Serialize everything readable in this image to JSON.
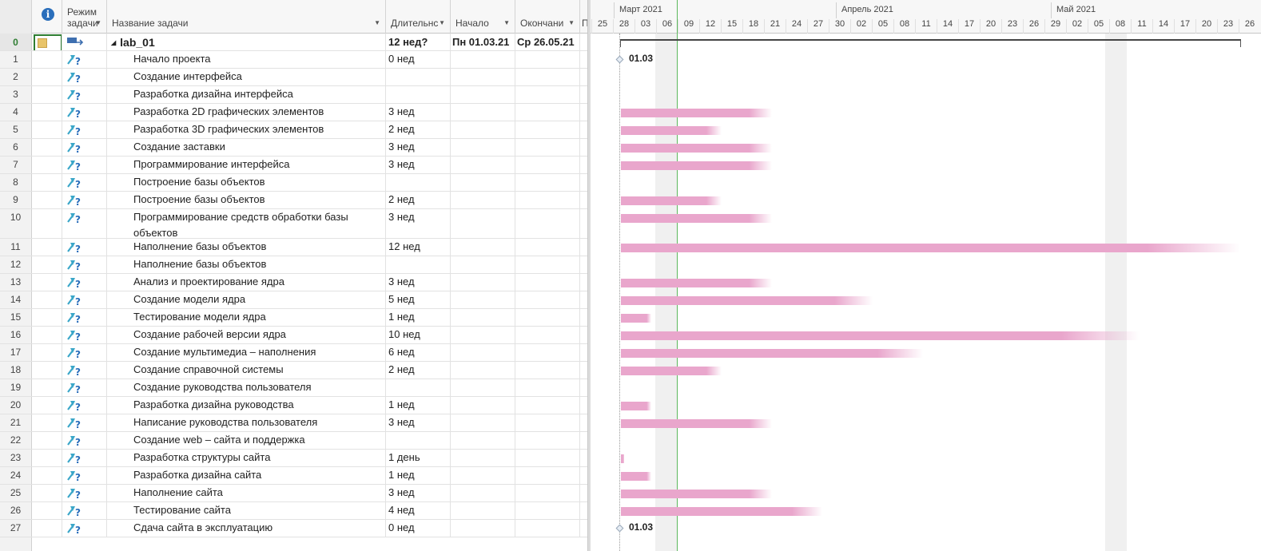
{
  "header": {
    "info_symbol": "i",
    "mode_label": "Режим задачи",
    "name_label": "Название задачи",
    "duration_label": "Длительнс",
    "start_label": "Начало",
    "finish_label": "Окончани",
    "pred_label": "П"
  },
  "summary": {
    "id": "0",
    "name": "lab_01",
    "duration": "12 нед?",
    "start": "Пн 01.03.21",
    "finish": "Ср 26.05.21"
  },
  "tasks": [
    {
      "id": "1",
      "name": "Начало проекта",
      "duration": "0 нед"
    },
    {
      "id": "2",
      "name": "Создание интерфейса",
      "duration": ""
    },
    {
      "id": "3",
      "name": "Разработка дизайна интерфейса",
      "duration": ""
    },
    {
      "id": "4",
      "name": "Разработка 2D графических элементов",
      "duration": "3 нед"
    },
    {
      "id": "5",
      "name": "Разработка 3D графических элементов",
      "duration": "2 нед"
    },
    {
      "id": "6",
      "name": "Создание заставки",
      "duration": "3 нед"
    },
    {
      "id": "7",
      "name": "Программирование интерфейса",
      "duration": "3 нед"
    },
    {
      "id": "8",
      "name": "Построение базы объектов",
      "duration": ""
    },
    {
      "id": "9",
      "name": "Построение базы объектов",
      "duration": "2 нед"
    },
    {
      "id": "10",
      "name": "Программирование средств обработки базы объектов",
      "duration": "3 нед"
    },
    {
      "id": "11",
      "name": "Наполнение базы объектов",
      "duration": "12 нед"
    },
    {
      "id": "12",
      "name": "Наполнение базы объектов",
      "duration": ""
    },
    {
      "id": "13",
      "name": "Анализ и проектирование ядра",
      "duration": "3 нед"
    },
    {
      "id": "14",
      "name": "Создание модели ядра",
      "duration": "5 нед"
    },
    {
      "id": "15",
      "name": "Тестирование модели ядра",
      "duration": "1 нед"
    },
    {
      "id": "16",
      "name": "Создание рабочей версии ядра",
      "duration": "10 нед"
    },
    {
      "id": "17",
      "name": "Создание мультимедиа – наполнения",
      "duration": "6 нед"
    },
    {
      "id": "18",
      "name": "Создание справочной системы",
      "duration": "2 нед"
    },
    {
      "id": "19",
      "name": "Создание руководства пользователя",
      "duration": ""
    },
    {
      "id": "20",
      "name": "Разработка дизайна руководства",
      "duration": "1 нед"
    },
    {
      "id": "21",
      "name": "Написание руководства пользователя",
      "duration": "3 нед"
    },
    {
      "id": "22",
      "name": "Создание web – сайта и поддержка",
      "duration": ""
    },
    {
      "id": "23",
      "name": "Разработка структуры сайта",
      "duration": "1 день"
    },
    {
      "id": "24",
      "name": "Разработка дизайна сайта",
      "duration": "1 нед"
    },
    {
      "id": "25",
      "name": "Наполнение сайта",
      "duration": "3 нед"
    },
    {
      "id": "26",
      "name": "Тестирование сайта",
      "duration": "4 нед"
    },
    {
      "id": "27",
      "name": "Сдача сайта в эксплуатацию",
      "duration": "0 нед"
    }
  ],
  "timescale": {
    "months": [
      "Март 2021",
      "Апрель 2021",
      "Май 2021"
    ],
    "days": [
      "25",
      "28",
      "03",
      "06",
      "09",
      "12",
      "15",
      "18",
      "21",
      "24",
      "27",
      "30",
      "02",
      "05",
      "08",
      "11",
      "14",
      "17",
      "20",
      "23",
      "26",
      "29",
      "02",
      "05",
      "08",
      "11",
      "14",
      "17",
      "20",
      "23",
      "26"
    ]
  },
  "milestones": {
    "start_label": "01.03",
    "end_label": "01.03"
  },
  "colors": {
    "bar": "#e9a6cc",
    "today_line": "#5cb85c",
    "summary_id": "#2e7d32"
  }
}
